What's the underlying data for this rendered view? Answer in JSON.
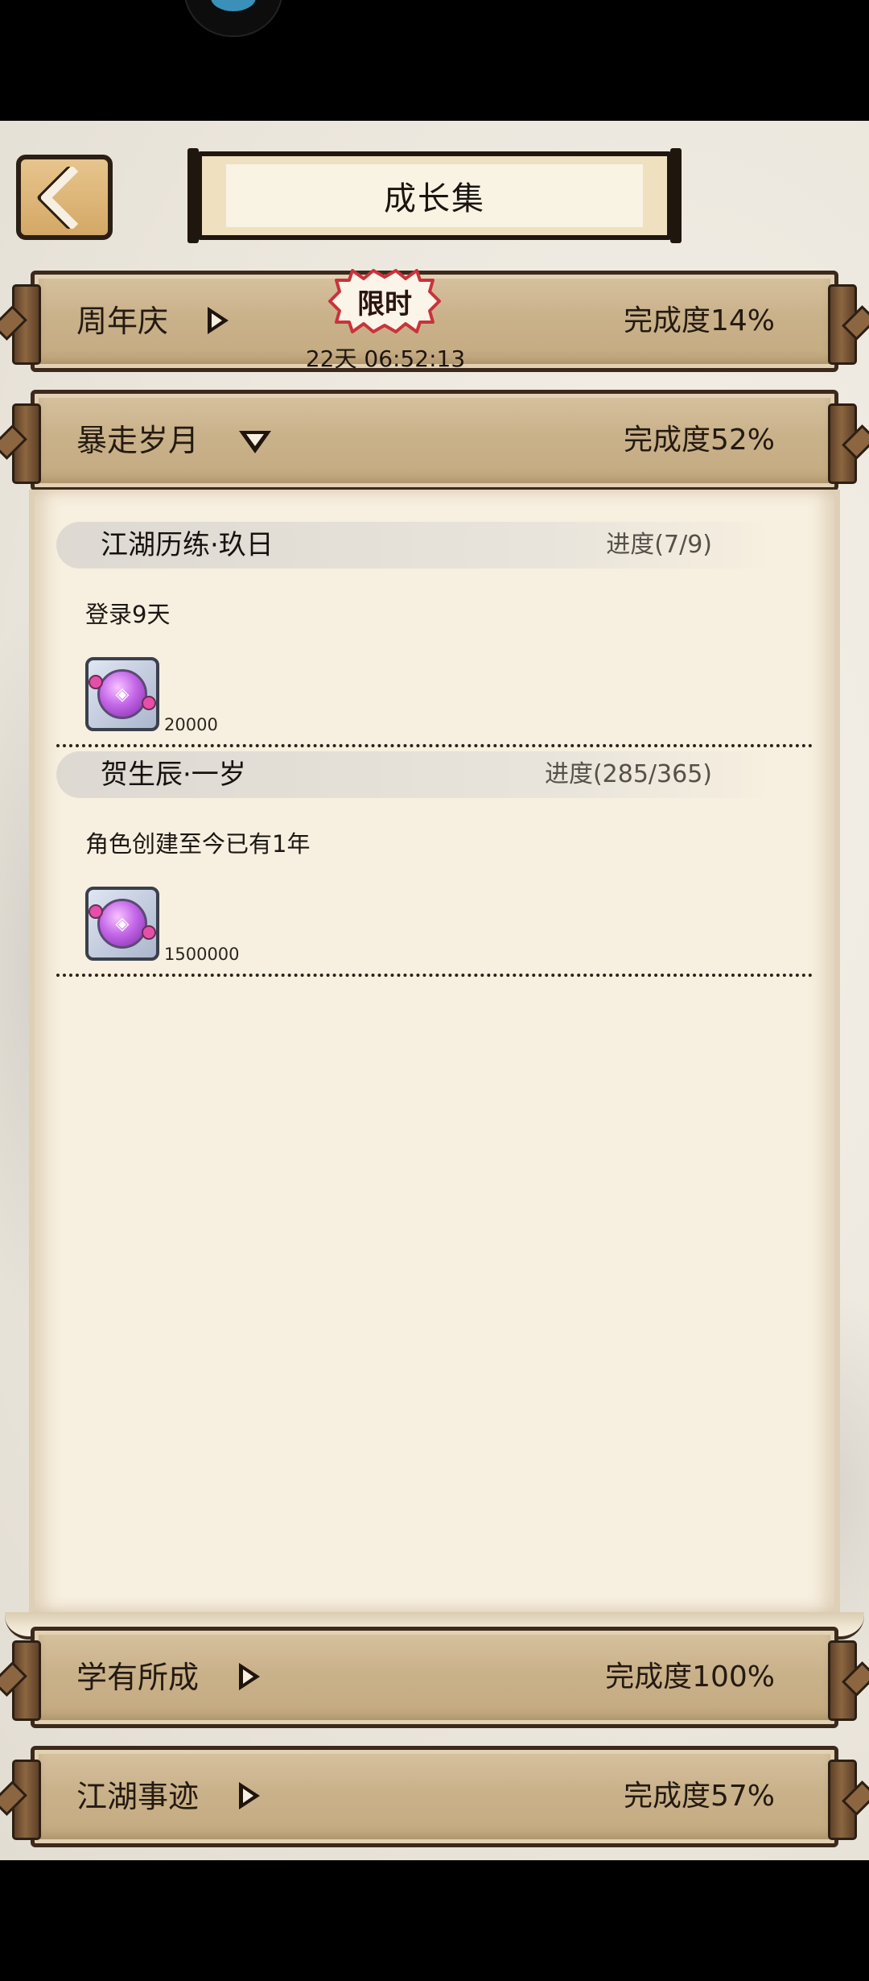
{
  "header": {
    "title": "成长集"
  },
  "sections": [
    {
      "label": "周年庆",
      "completion": "完成度14%",
      "expanded": false,
      "badge": "限时",
      "countdown": "22天 06:52:13"
    },
    {
      "label": "暴走岁月",
      "completion": "完成度52%",
      "expanded": true
    },
    {
      "label": "学有所成",
      "completion": "完成度100%",
      "expanded": false
    },
    {
      "label": "江湖事迹",
      "completion": "完成度57%",
      "expanded": false
    }
  ],
  "tasks": [
    {
      "name": "江湖历练·玖日",
      "progress": "进度(7/9)",
      "description": "登录9天",
      "reward_icon": "purple-orb-icon",
      "reward_amount": "20000"
    },
    {
      "name": "贺生辰·一岁",
      "progress": "进度(285/365)",
      "description": "角色创建至今已有1年",
      "reward_icon": "purple-orb-icon",
      "reward_amount": "1500000"
    }
  ],
  "colors": {
    "band": "#c9b18a",
    "panel": "#f7efdf",
    "badge_border": "#c8333b",
    "back_button": "#d9b274"
  }
}
